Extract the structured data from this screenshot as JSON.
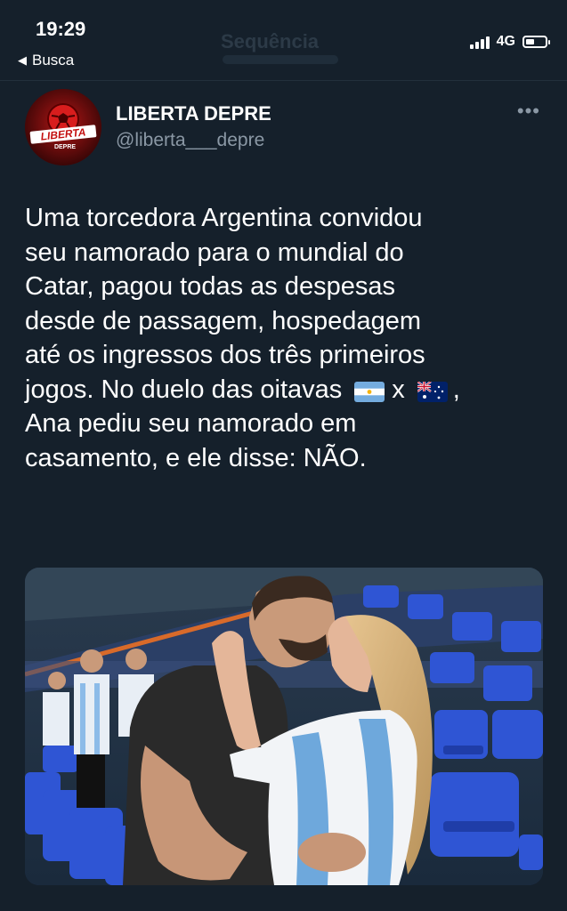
{
  "status_bar": {
    "time": "19:29",
    "back_label": "Busca",
    "ghost_title": "Sequência",
    "network": "4G",
    "battery_level": 0.45
  },
  "tweet": {
    "display_name": "LIBERTA DEPRE",
    "handle": "@liberta___depre",
    "avatar_logo_text": "LIBERTA DEPRE",
    "text_lines": [
      "Uma torcedora Argentina convidou",
      "seu namorado para o mundial do",
      "Catar, pagou todas as despesas",
      "desde de passagem, hospedagem",
      "até os ingressos dos três primeiros",
      "jogos. No duelo das oitavas",
      "x",
      ",",
      "Ana pediu seu namorado em",
      "casamento, e ele disse: NÃO."
    ],
    "flags": [
      "argentina-flag",
      "australia-flag"
    ],
    "photo_description": "couple-kissing-in-stadium-photo"
  },
  "colors": {
    "background": "#15202b",
    "secondary_text": "#8b98a5",
    "seat_blue": "#2f55d4"
  },
  "icons": [
    "back-arrow-icon",
    "signal-icon",
    "battery-icon",
    "more-options-icon"
  ]
}
